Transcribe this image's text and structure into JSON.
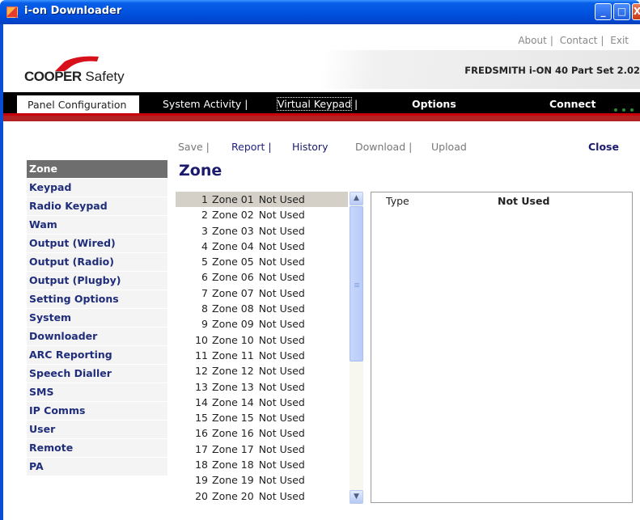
{
  "window": {
    "title": "i-on Downloader",
    "minimize": "_",
    "maximize": "□",
    "close": "X"
  },
  "toplinks": {
    "about": "About",
    "contact": "Contact",
    "exit": "Exit",
    "sep": "|"
  },
  "brand": {
    "name_bold": "COOPER",
    "name_rest": "Safety"
  },
  "panel_name": "FREDSMITH i-ON 40 Part Set 2.02",
  "nav": {
    "panel_configuration": "Panel Configuration",
    "system_activity": "System Activity |",
    "virtual_keypad": "Virtual Keypad",
    "virtual_sep": "|",
    "options": "Options",
    "connect": "Connect"
  },
  "toolbar": {
    "save": "Save |",
    "report": "Report |",
    "history": "History",
    "download": "Download |",
    "upload": "Upload",
    "close": "Close"
  },
  "sidebar": {
    "items": [
      "Zone",
      "Keypad",
      "Radio Keypad",
      "Wam",
      "Output (Wired)",
      "Output (Radio)",
      "Output (Plugby)",
      "Setting Options",
      "System",
      "Downloader",
      "ARC Reporting",
      "Speech Dialler",
      "SMS",
      "IP Comms",
      "User",
      "Remote",
      "PA"
    ],
    "selected": "Zone"
  },
  "page_title": "Zone",
  "zones": [
    {
      "num": "1",
      "name": "Zone 01",
      "status": "Not Used"
    },
    {
      "num": "2",
      "name": "Zone 02",
      "status": "Not Used"
    },
    {
      "num": "3",
      "name": "Zone 03",
      "status": "Not Used"
    },
    {
      "num": "4",
      "name": "Zone 04",
      "status": "Not Used"
    },
    {
      "num": "5",
      "name": "Zone 05",
      "status": "Not Used"
    },
    {
      "num": "6",
      "name": "Zone 06",
      "status": "Not Used"
    },
    {
      "num": "7",
      "name": "Zone 07",
      "status": "Not Used"
    },
    {
      "num": "8",
      "name": "Zone 08",
      "status": "Not Used"
    },
    {
      "num": "9",
      "name": "Zone 09",
      "status": "Not Used"
    },
    {
      "num": "10",
      "name": "Zone 10",
      "status": "Not Used"
    },
    {
      "num": "11",
      "name": "Zone 11",
      "status": "Not Used"
    },
    {
      "num": "12",
      "name": "Zone 12",
      "status": "Not Used"
    },
    {
      "num": "13",
      "name": "Zone 13",
      "status": "Not Used"
    },
    {
      "num": "14",
      "name": "Zone 14",
      "status": "Not Used"
    },
    {
      "num": "15",
      "name": "Zone 15",
      "status": "Not Used"
    },
    {
      "num": "16",
      "name": "Zone 16",
      "status": "Not Used"
    },
    {
      "num": "17",
      "name": "Zone 17",
      "status": "Not Used"
    },
    {
      "num": "18",
      "name": "Zone 18",
      "status": "Not Used"
    },
    {
      "num": "19",
      "name": "Zone 19",
      "status": "Not Used"
    },
    {
      "num": "20",
      "name": "Zone 20",
      "status": "Not Used"
    }
  ],
  "detail": {
    "type_label": "Type",
    "type_value": "Not Used"
  },
  "colors": {
    "accent_red": "#c8000a",
    "nav_black": "#000000",
    "link_blue": "#1a1a6e",
    "connect_dot": "#2c8c2c"
  }
}
